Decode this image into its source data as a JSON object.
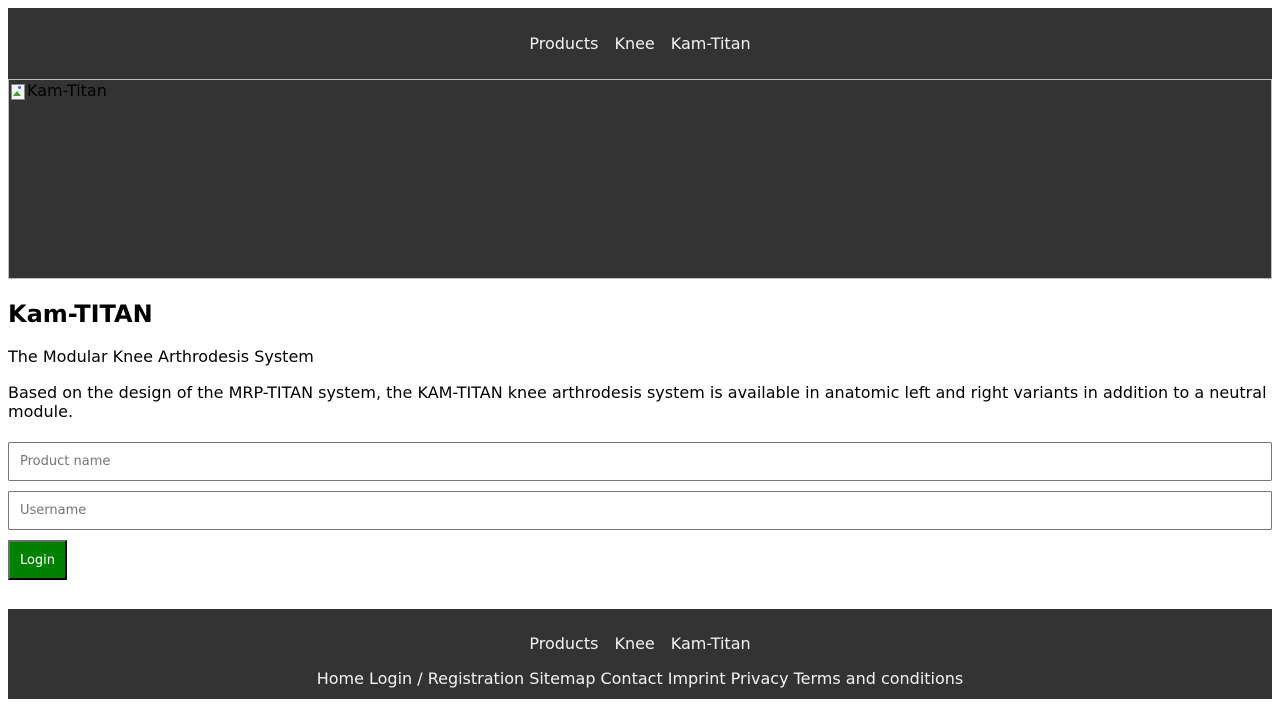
{
  "top_nav": {
    "items": [
      {
        "label": "Products"
      },
      {
        "label": "Knee"
      },
      {
        "label": "Kam-Titan"
      }
    ]
  },
  "hero": {
    "image_alt": "Kam-Titan"
  },
  "content": {
    "title": "Kam-TITAN",
    "subtitle": "The Modular Knee Arthrodesis System",
    "description": "Based on the design of the MRP-TITAN system, the KAM-TITAN knee arthrodesis system is available in anatomic left and right variants in addition to a neutral module."
  },
  "login_form": {
    "product_placeholder": "Product name",
    "username_placeholder": "Username",
    "login_label": "Login"
  },
  "footer": {
    "nav_items": [
      {
        "label": "Products"
      },
      {
        "label": "Knee"
      },
      {
        "label": "Kam-Titan"
      }
    ],
    "links": [
      {
        "label": "Home"
      },
      {
        "label": "Login / Registration"
      },
      {
        "label": "Sitemap"
      },
      {
        "label": "Contact"
      },
      {
        "label": "Imprint"
      },
      {
        "label": "Privacy"
      },
      {
        "label": "Terms and conditions"
      }
    ]
  },
  "colors": {
    "header_bg": "#333333",
    "nav_text": "#f2f2f2",
    "button_bg": "#008000"
  }
}
